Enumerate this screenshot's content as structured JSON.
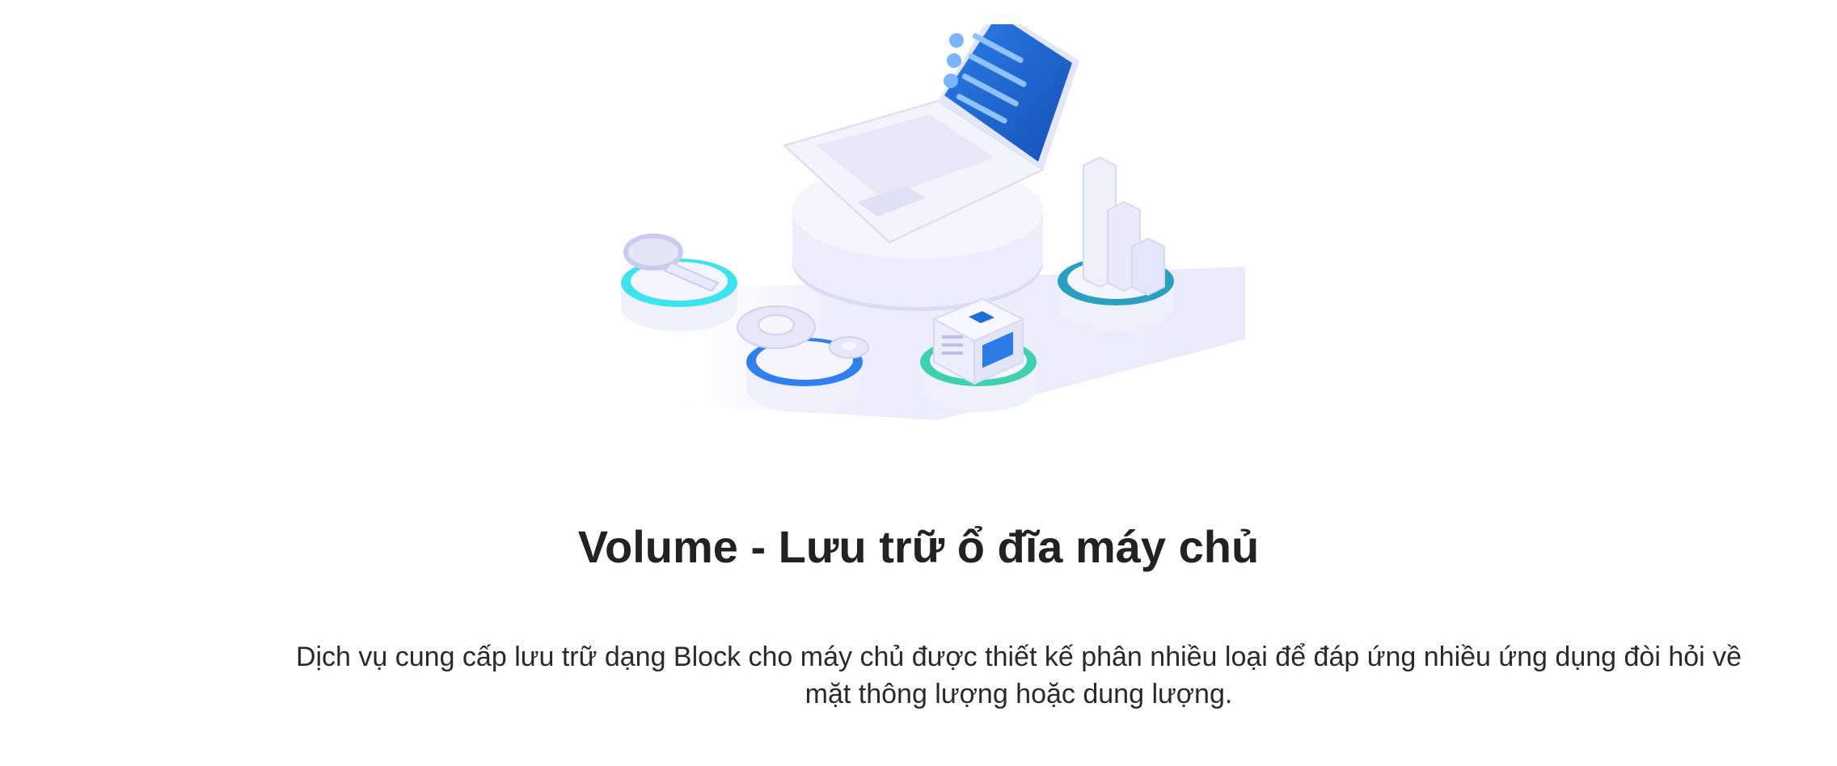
{
  "section": {
    "title": "Volume - Lưu trữ ổ đĩa máy chủ",
    "description": "Dịch vụ cung cấp lưu trữ dạng Block cho máy chủ được thiết kế phân nhiều loại để đáp ứng nhiều ứng dụng đòi hỏi về mặt thông lượng hoặc dung lượng."
  },
  "illustration": {
    "icons": [
      "laptop-icon",
      "magnifier-icon",
      "gear-icon",
      "server-icon",
      "bar-chart-icon"
    ],
    "colors": {
      "screen": "#1e6fd9",
      "cyan_ring": "#3fe3f0",
      "blue_ring": "#2f7ff0",
      "teal_ring": "#2a9fc0",
      "green_ring": "#3fd0b0",
      "platform": "#eef0fb",
      "shadow": "#d9dcf5"
    }
  }
}
